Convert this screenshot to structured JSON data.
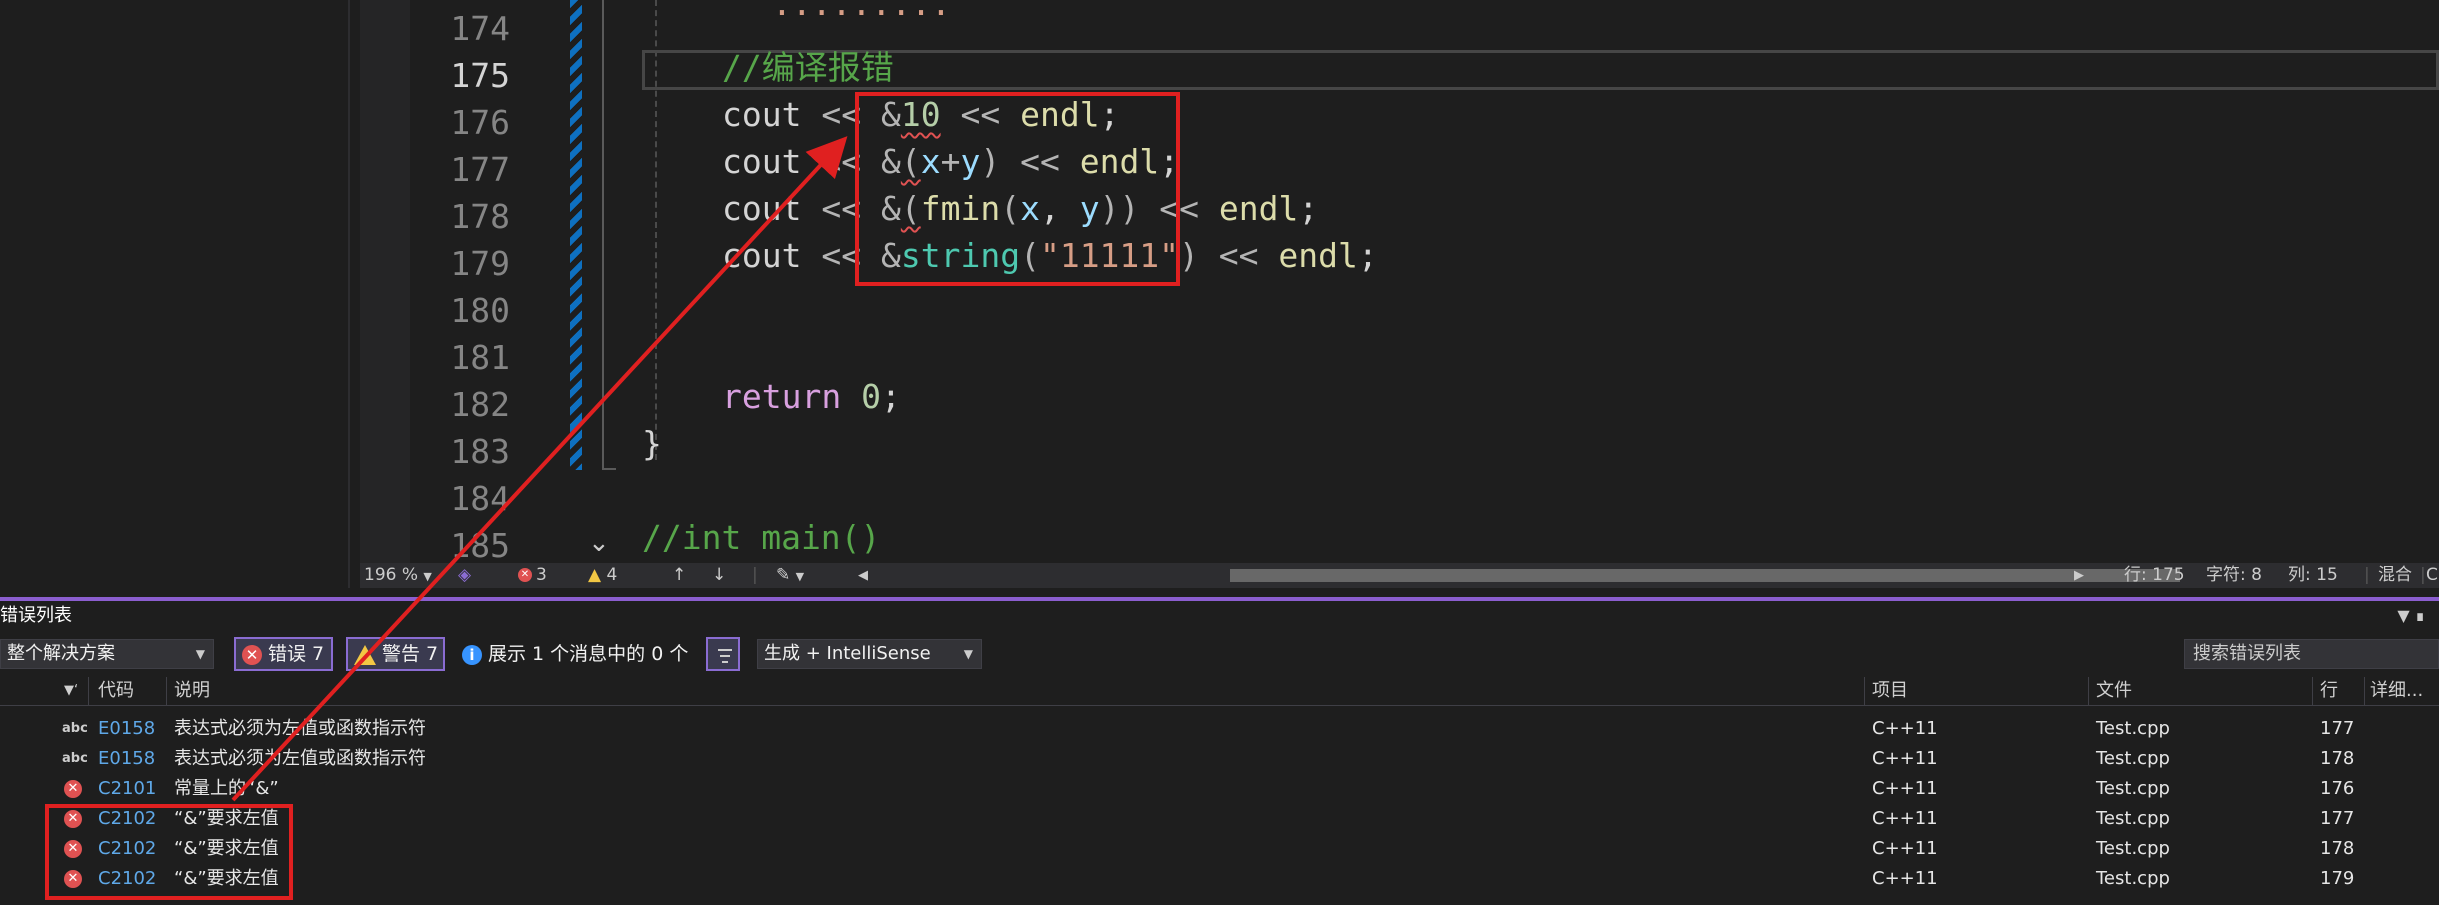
{
  "editor": {
    "lines": [
      {
        "num": "174"
      },
      {
        "num": "175"
      },
      {
        "num": "176"
      },
      {
        "num": "177"
      },
      {
        "num": "178"
      },
      {
        "num": "179"
      },
      {
        "num": "180"
      },
      {
        "num": "181"
      },
      {
        "num": "182"
      },
      {
        "num": "183"
      },
      {
        "num": "184"
      },
      {
        "num": "185"
      }
    ],
    "code": {
      "l175_comment": "//编译报错",
      "cout": "cout",
      "shl": "<<",
      "amp": "&",
      "endl": "endl",
      "semi": ";",
      "l176_num": "10",
      "l177_lp": "(",
      "l177_x": "x",
      "l177_plus": "+",
      "l177_y": "y",
      "l177_rp": ")",
      "l178_lp": "(",
      "l178_fn": "fmin",
      "l178_lp2": "(",
      "l178_x": "x",
      "l178_comma": ", ",
      "l178_y": "y",
      "l178_rp": "))",
      "l179_type": "string",
      "l179_lp": "(",
      "l179_str": "\"11111\"",
      "l179_rp": ")",
      "l182_return": "return",
      "l182_zero": "0",
      "l183_brace": "}",
      "l185_comment": "//int main()"
    },
    "status": {
      "zoom": "196 %",
      "errors": "3",
      "warnings": "4",
      "row": "行: 175",
      "char": "字符: 8",
      "col": "列: 15",
      "mode": "混合",
      "crlf": "CRLF"
    }
  },
  "error_list": {
    "title": "错误列表",
    "scope": "整个解决方案",
    "errors_btn": "错误 7",
    "warnings_btn": "警告 7",
    "messages": "展示 1 个消息中的 0 个",
    "build_filter": "生成 + IntelliSense",
    "search_placeholder": "搜索错误列表",
    "columns": {
      "code": "代码",
      "desc": "说明",
      "project": "项目",
      "file": "文件",
      "line": "行",
      "detail": "详细..."
    },
    "rows": [
      {
        "type": "intellisense",
        "code": "E0158",
        "desc": "表达式必须为左值或函数指示符",
        "project": "C++11",
        "file": "Test.cpp",
        "line": "177"
      },
      {
        "type": "intellisense",
        "code": "E0158",
        "desc": "表达式必须为左值或函数指示符",
        "project": "C++11",
        "file": "Test.cpp",
        "line": "178"
      },
      {
        "type": "error",
        "code": "C2101",
        "desc": "常量上的“&”",
        "project": "C++11",
        "file": "Test.cpp",
        "line": "176"
      },
      {
        "type": "error",
        "code": "C2102",
        "desc": "“&”要求左值",
        "project": "C++11",
        "file": "Test.cpp",
        "line": "177"
      },
      {
        "type": "error",
        "code": "C2102",
        "desc": "“&”要求左值",
        "project": "C++11",
        "file": "Test.cpp",
        "line": "178"
      },
      {
        "type": "error",
        "code": "C2102",
        "desc": "“&”要求左值",
        "project": "C++11",
        "file": "Test.cpp",
        "line": "179"
      }
    ]
  },
  "colors": {
    "annotation": "#e02020",
    "accent": "#8a6cd2",
    "error": "#e05252",
    "warning": "#f2c744"
  }
}
